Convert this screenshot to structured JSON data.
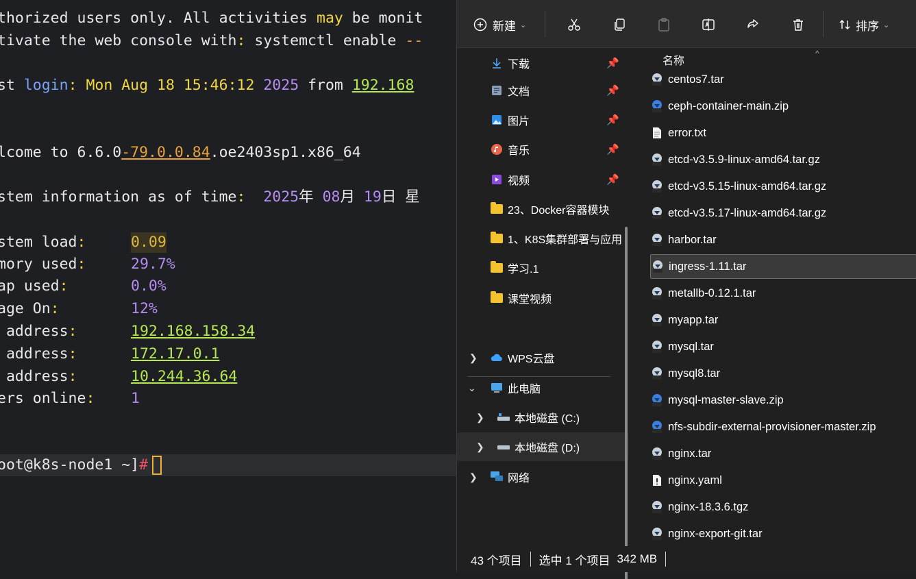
{
  "terminal": {
    "lines": {
      "l1a": "thorized users only. All activities ",
      "l1b": "may",
      "l1c": " be monit",
      "l2a": "tivate the web console with",
      "l2b": ":",
      "l2c": " systemctl enable ",
      "l2d": "--",
      "l3a": "st ",
      "l3b": "login",
      "l3c": ": Mon Aug 18 15:46:12 ",
      "l3d": "2025",
      "l3e": " from ",
      "l3f": "192.168",
      "l4a": "lcome to 6.6.0",
      "l4b": "-79.0.0.84",
      "l4c": ".oe2403sp1.x86_64",
      "l5a": "stem information as of time",
      "l5b": ":",
      "l5c": "  ",
      "l5d": "2025",
      "l5e": "年 ",
      "l5f": "08",
      "l5g": "月 ",
      "l5h": "19",
      "l5i": "日 星"
    },
    "info": [
      {
        "label": "stem load",
        "value": "0.09"
      },
      {
        "label": "mory used",
        "value": "29.7%"
      },
      {
        "label": "ap used",
        "value": "0.0%"
      },
      {
        "label": "age On",
        "value": "12%"
      },
      {
        "label": " address",
        "value": "192.168.158.34"
      },
      {
        "label": " address",
        "value": "172.17.0.1"
      },
      {
        "label": " address",
        "value": "10.244.36.64"
      },
      {
        "label": "ers online",
        "value": "1"
      }
    ],
    "colon": ":",
    "prompt_user": "oot@k8s-node1 ~]",
    "prompt_hash": "#"
  },
  "toolbar": {
    "new_label": "新建",
    "sort_label": "排序",
    "icons": [
      "plus-circle-icon",
      "cut-icon",
      "copy-icon",
      "paste-icon",
      "rename-icon",
      "share-icon",
      "delete-icon",
      "sort-icon"
    ]
  },
  "nav": {
    "quick": [
      {
        "label": "下载",
        "icon": "download-icon"
      },
      {
        "label": "文档",
        "icon": "documents-icon"
      },
      {
        "label": "图片",
        "icon": "pictures-icon"
      },
      {
        "label": "音乐",
        "icon": "music-icon"
      },
      {
        "label": "视频",
        "icon": "videos-icon"
      }
    ],
    "folders": [
      "23、Docker容器模块",
      "1、K8S集群部署与应用",
      "学习.1",
      "课堂视频"
    ],
    "tree": [
      {
        "label": "WPS云盘",
        "icon": "cloud-icon"
      },
      {
        "label": "此电脑",
        "icon": "this-pc-icon"
      },
      {
        "label": "本地磁盘 (C:)",
        "icon": "drive-c-icon"
      },
      {
        "label": "本地磁盘 (D:)",
        "icon": "drive-d-icon"
      },
      {
        "label": "网络",
        "icon": "network-icon"
      }
    ]
  },
  "files": {
    "column_name": "名称",
    "items": [
      {
        "name": "centos7.tar",
        "type": "tar"
      },
      {
        "name": "ceph-container-main.zip",
        "type": "zip"
      },
      {
        "name": "error.txt",
        "type": "txt"
      },
      {
        "name": "etcd-v3.5.9-linux-amd64.tar.gz",
        "type": "gz"
      },
      {
        "name": "etcd-v3.5.15-linux-amd64.tar.gz",
        "type": "gz"
      },
      {
        "name": "etcd-v3.5.17-linux-amd64.tar.gz",
        "type": "gz"
      },
      {
        "name": "harbor.tar",
        "type": "tar"
      },
      {
        "name": "ingress-1.11.tar",
        "type": "tar"
      },
      {
        "name": "metallb-0.12.1.tar",
        "type": "tar"
      },
      {
        "name": "myapp.tar",
        "type": "tar"
      },
      {
        "name": "mysql.tar",
        "type": "tar"
      },
      {
        "name": "mysql8.tar",
        "type": "tar"
      },
      {
        "name": "mysql-master-slave.zip",
        "type": "zip"
      },
      {
        "name": "nfs-subdir-external-provisioner-master.zip",
        "type": "zip"
      },
      {
        "name": "nginx.tar",
        "type": "tar"
      },
      {
        "name": "nginx.yaml",
        "type": "yaml"
      },
      {
        "name": "nginx-18.3.6.tgz",
        "type": "tgz"
      },
      {
        "name": "nginx-export-git.tar",
        "type": "tar"
      }
    ]
  },
  "status": {
    "count": "43 个项目",
    "selected": "选中 1 个项目",
    "size": "342 MB"
  },
  "colors": {
    "terminal_bg": "#1e1f22",
    "explorer_bg": "#202020",
    "folder": "#f4c430"
  }
}
